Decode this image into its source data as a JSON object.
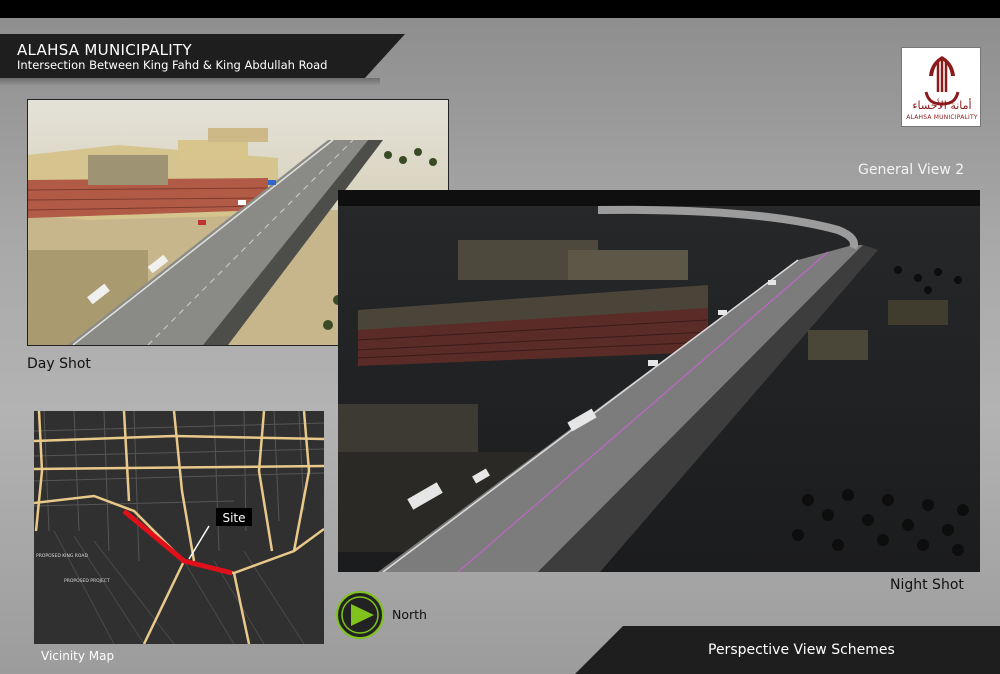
{
  "header": {
    "title": "ALAHSA MUNICIPALITY",
    "subtitle": "Intersection Between King Fahd & King Abdullah Road"
  },
  "logo": {
    "arabic_text": "أمانة الأحساء",
    "english_text": "ALAHSA MUNICIPALITY"
  },
  "views": {
    "general_view": "General View 2",
    "day_caption": "Day Shot",
    "night_caption": "Night Shot"
  },
  "map": {
    "site_label": "Site",
    "road_label_1": "PROPOSED KING ROAD",
    "road_label_2": "PROPOSED PROJECT",
    "caption": "Vicinity Map"
  },
  "north": {
    "label": "North"
  },
  "footer": {
    "text": "Perspective View Schemes"
  },
  "colors": {
    "header_band": "#1e1e1e",
    "site_route": "#e0101a",
    "map_roads": "#e9c98a",
    "north_arrow": "#7fc31c",
    "logo_red": "#8b1a1a"
  }
}
